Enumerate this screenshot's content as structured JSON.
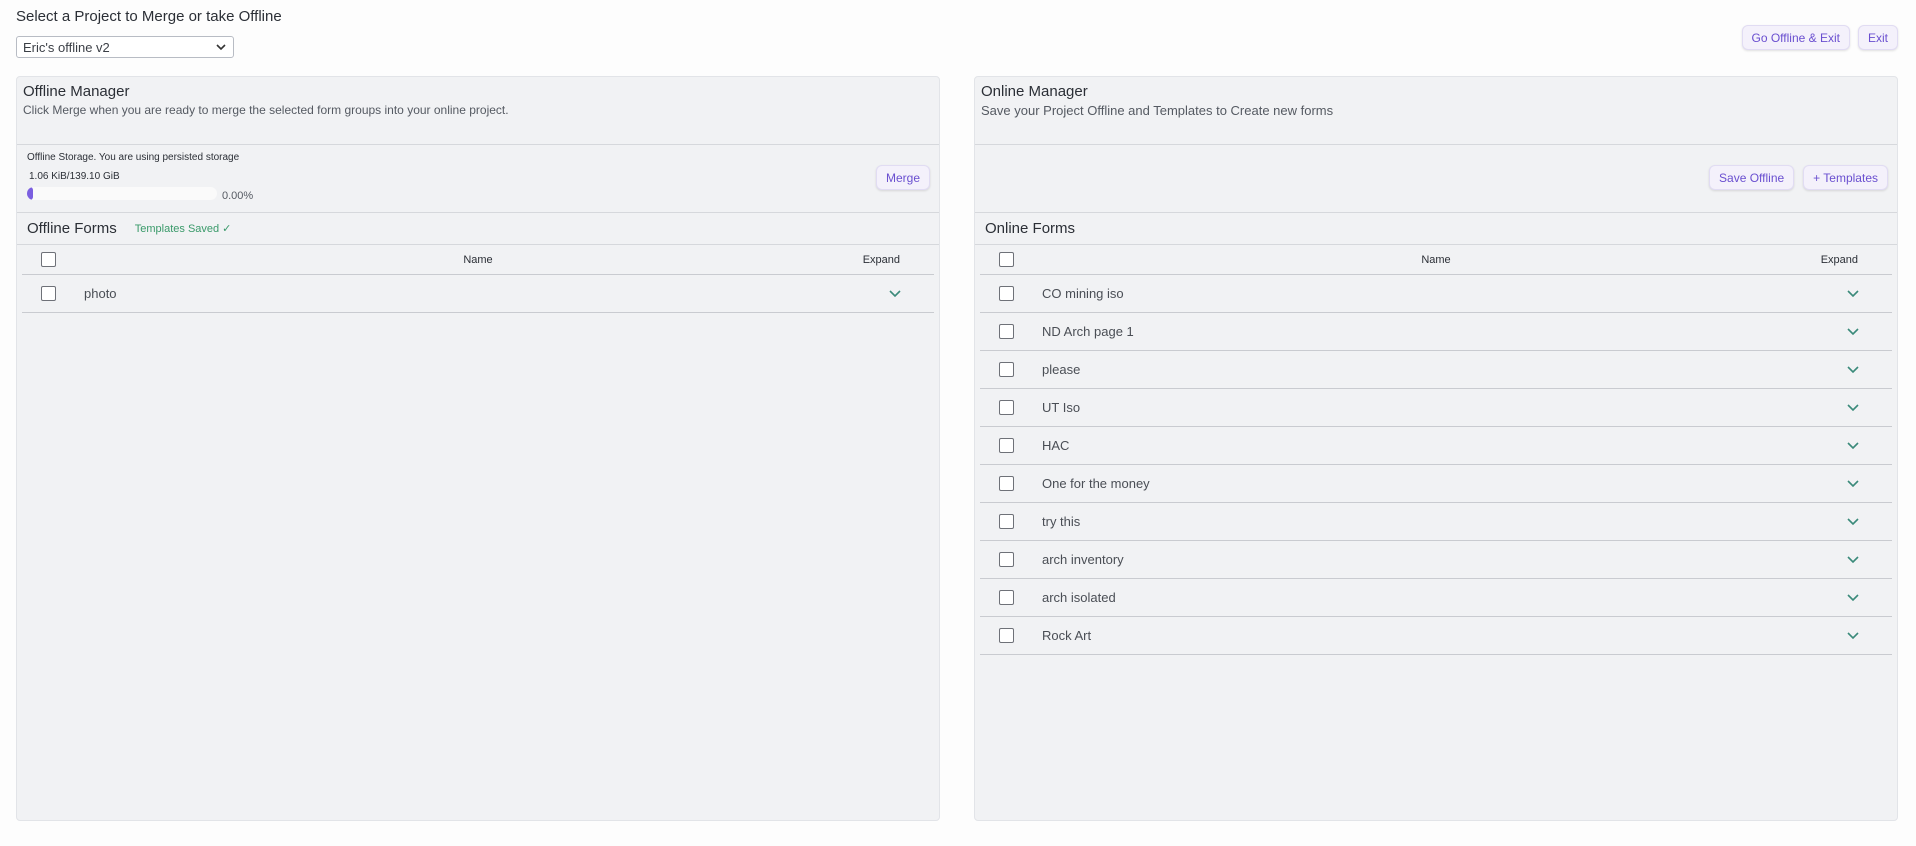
{
  "page": {
    "title": "Select a Project to Merge or take Offline",
    "project_select_value": "Eric's offline v2"
  },
  "top_actions": {
    "go_offline_label": "Go Offline & Exit",
    "exit_label": "Exit"
  },
  "offline_manager": {
    "title": "Offline Manager",
    "subtitle": "Click Merge when you are ready to merge the selected form groups into your online project.",
    "storage_label": "Offline Storage. You are using persisted storage",
    "storage_size": "1.06 KiB/139.10 GiB",
    "storage_percent_text": "0.00%",
    "storage_fill_fraction": 0.0,
    "merge_label": "Merge",
    "forms_title": "Offline Forms",
    "templates_saved": "Templates Saved ✓",
    "col_name": "Name",
    "col_expand": "Expand",
    "forms": [
      {
        "name": "photo"
      }
    ]
  },
  "online_manager": {
    "title": "Online Manager",
    "subtitle": "Save your Project Offline and Templates to Create new forms",
    "save_offline_label": "Save Offline",
    "templates_label": "+ Templates",
    "forms_title": "Online Forms",
    "col_name": "Name",
    "col_expand": "Expand",
    "forms": [
      {
        "name": "CO mining iso"
      },
      {
        "name": "ND Arch page 1"
      },
      {
        "name": "please"
      },
      {
        "name": "UT Iso"
      },
      {
        "name": "HAC"
      },
      {
        "name": "One for the money"
      },
      {
        "name": "try this"
      },
      {
        "name": "arch inventory"
      },
      {
        "name": "arch isolated"
      },
      {
        "name": "Rock Art"
      }
    ]
  },
  "colors": {
    "accent": "#6a4fd0",
    "progress_fill": "#7b5fe0",
    "success": "#3a9a6a",
    "chevron": "#3a8a7a"
  },
  "icons": {
    "select_chevron": "chevron-down-icon",
    "row_expand": "chevron-down-icon"
  }
}
